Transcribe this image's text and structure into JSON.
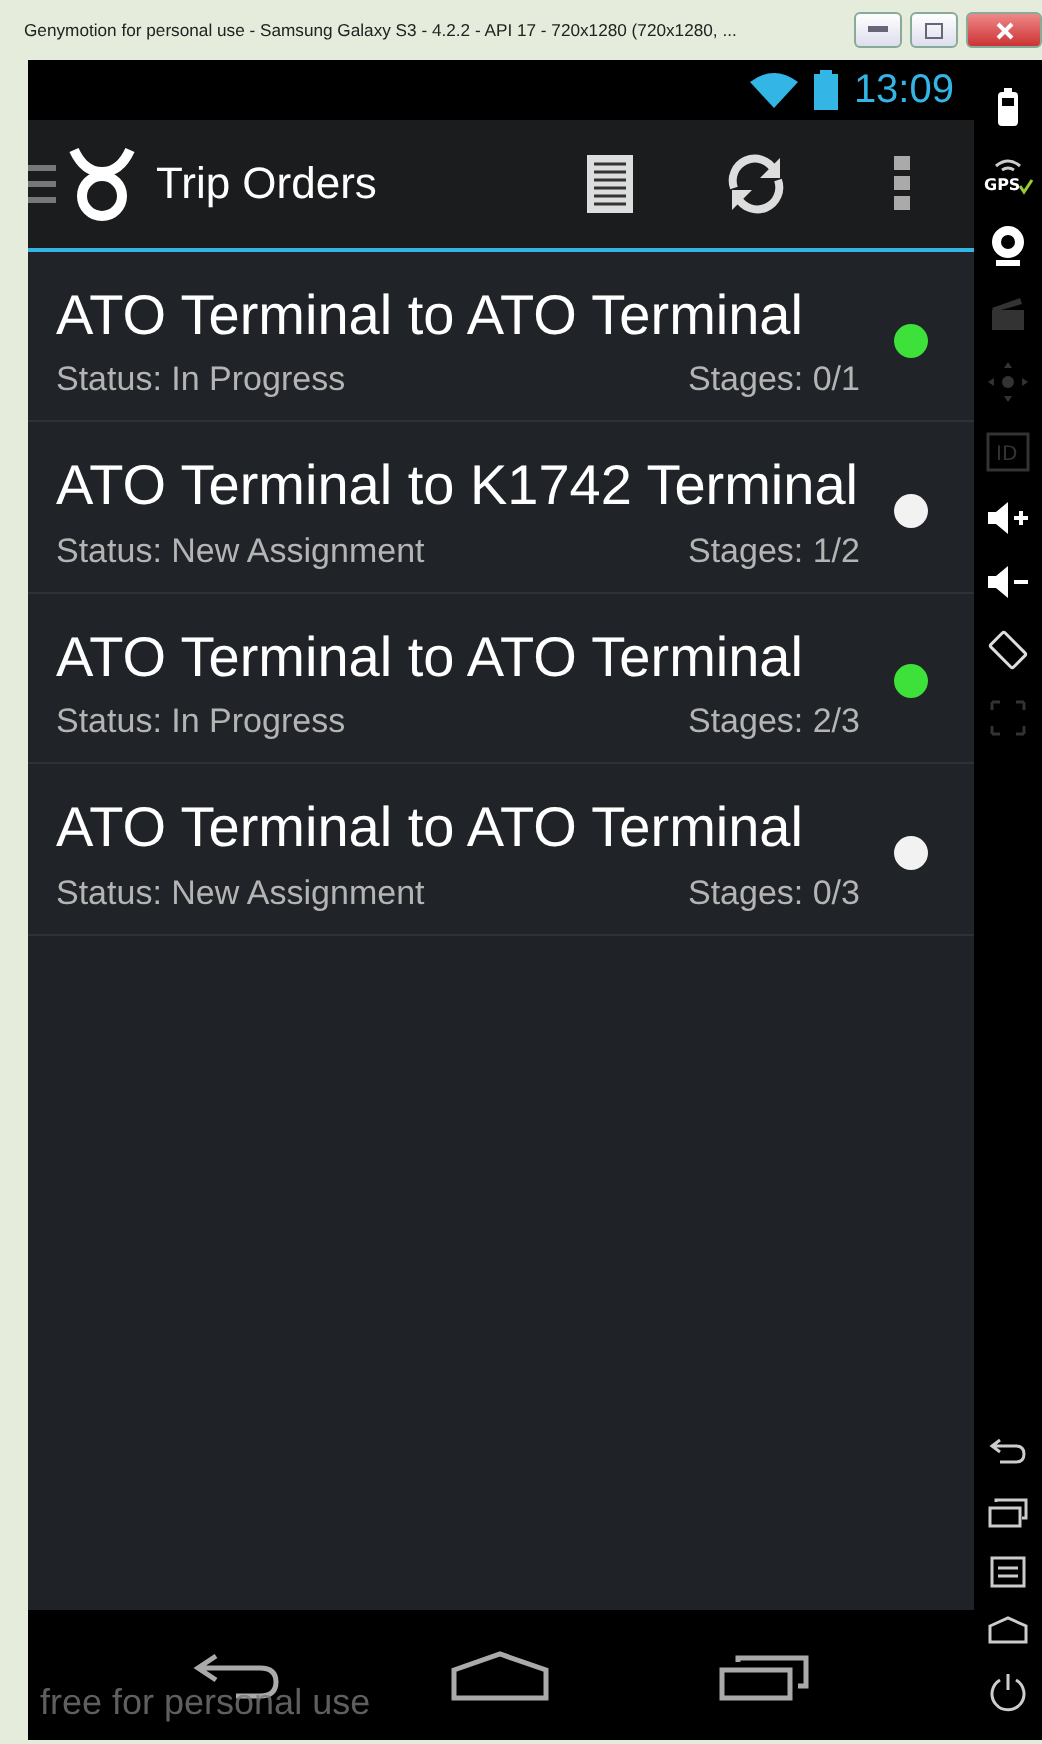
{
  "window": {
    "title": "Genymotion for personal use - Samsung Galaxy S3 - 4.2.2 - API 17 - 720x1280 (720x1280, ..."
  },
  "status_bar": {
    "time": "13:09"
  },
  "action_bar": {
    "title": "Trip Orders"
  },
  "trips": [
    {
      "title": "ATO Terminal to ATO Terminal",
      "status": "Status: In Progress",
      "stages": "Stages: 0/1",
      "color": "#3ee03a"
    },
    {
      "title": "ATO Terminal to K1742 Terminal",
      "status": "Status: New Assignment",
      "stages": "Stages: 1/2",
      "color": "#f2f2f2"
    },
    {
      "title": "ATO Terminal to ATO Terminal",
      "status": "Status: In Progress",
      "stages": "Stages: 2/3",
      "color": "#3ee03a"
    },
    {
      "title": "ATO Terminal to ATO Terminal",
      "status": "Status: New Assignment",
      "stages": "Stages: 0/3",
      "color": "#f2f2f2"
    }
  ],
  "side_toolbar": {
    "gps_label": "GPS",
    "id_label": "ID"
  },
  "overlay": {
    "text": "free for personal use"
  }
}
